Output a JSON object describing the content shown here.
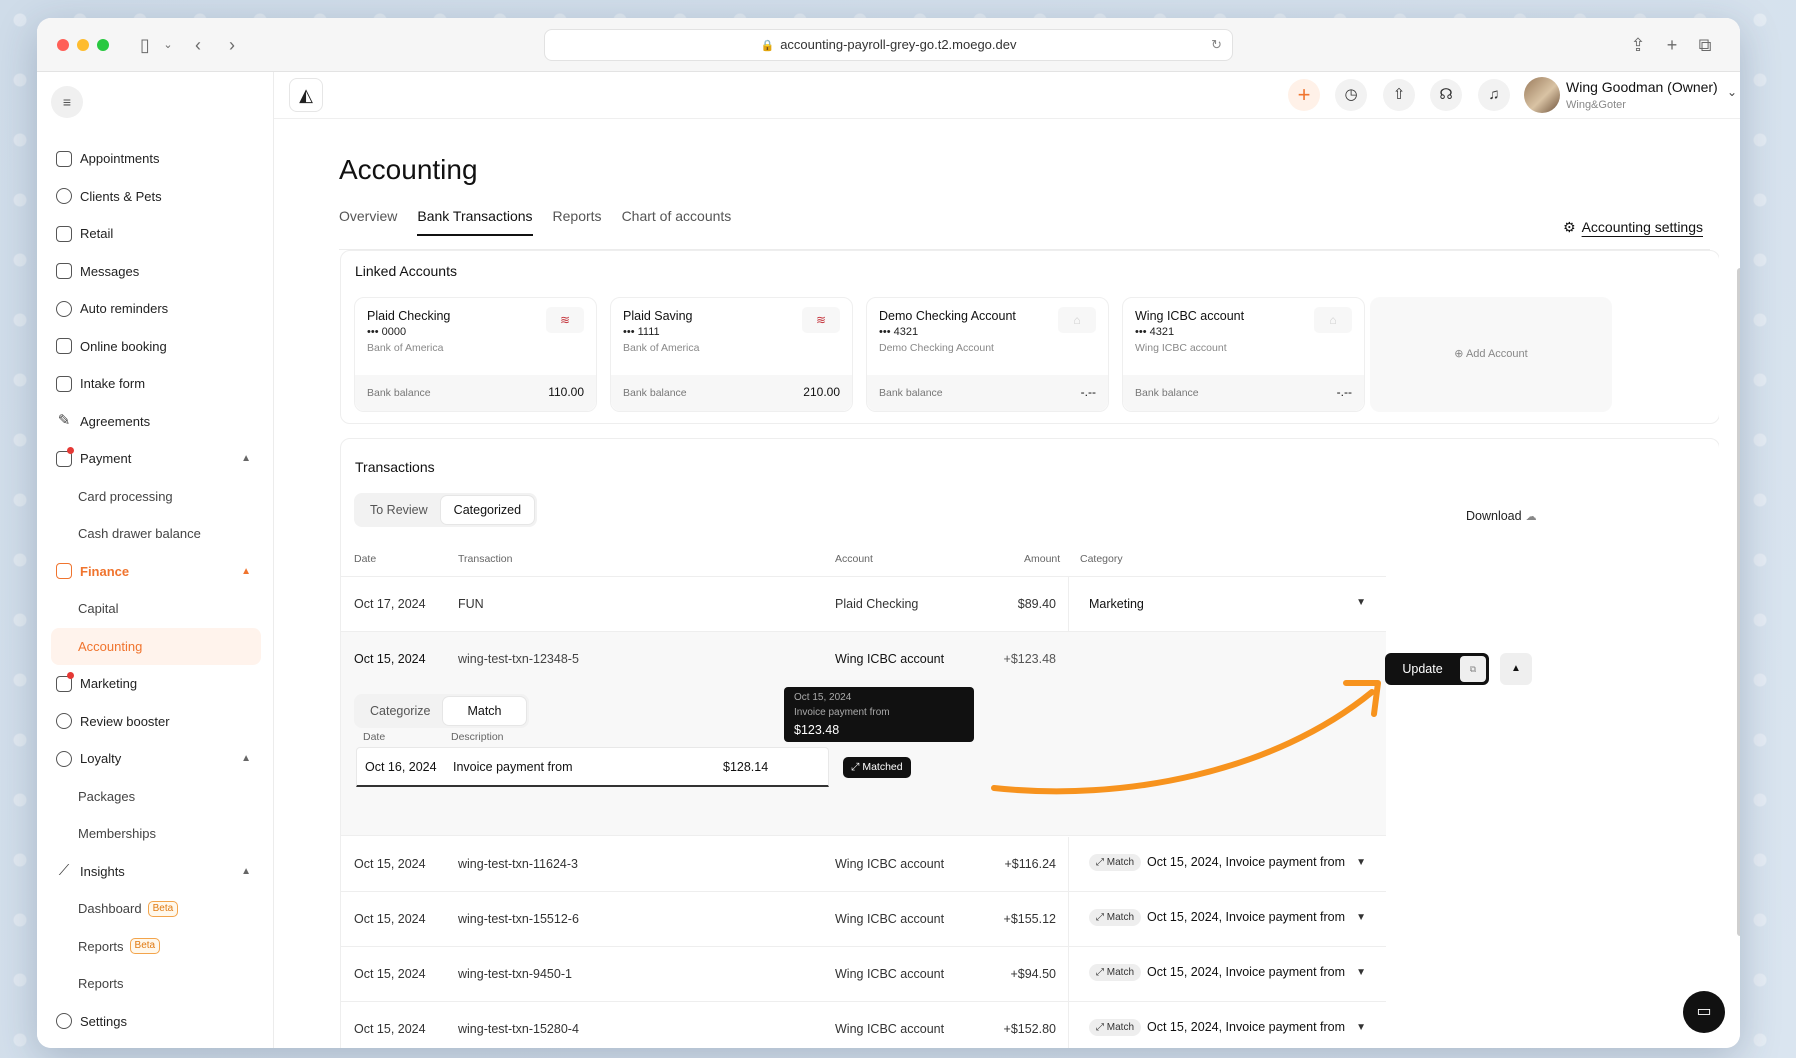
{
  "browser": {
    "url": "accounting-payroll-grey-go.t2.moego.dev"
  },
  "sidebar": {
    "items": [
      {
        "label": "Appointments",
        "icon": "calendar-icon"
      },
      {
        "label": "Clients & Pets",
        "icon": "user-icon"
      },
      {
        "label": "Retail",
        "icon": "store-icon"
      },
      {
        "label": "Messages",
        "icon": "message-icon"
      },
      {
        "label": "Auto reminders",
        "icon": "alarm-icon"
      },
      {
        "label": "Online booking",
        "icon": "booking-icon"
      },
      {
        "label": "Intake form",
        "icon": "clipboard-icon"
      },
      {
        "label": "Agreements",
        "icon": "pen-icon"
      },
      {
        "label": "Payment",
        "icon": "wallet-icon"
      },
      {
        "label": "Card processing"
      },
      {
        "label": "Cash drawer balance"
      },
      {
        "label": "Finance",
        "icon": "bank-icon"
      },
      {
        "label": "Capital"
      },
      {
        "label": "Accounting"
      },
      {
        "label": "Marketing",
        "icon": "megaphone-icon"
      },
      {
        "label": "Review booster",
        "icon": "people-icon"
      },
      {
        "label": "Loyalty",
        "icon": "heart-icon"
      },
      {
        "label": "Packages"
      },
      {
        "label": "Memberships"
      },
      {
        "label": "Insights",
        "icon": "chart-icon"
      },
      {
        "label": "Dashboard",
        "badge": "Beta"
      },
      {
        "label": "Reports",
        "badge": "Beta"
      },
      {
        "label": "Reports"
      },
      {
        "label": "Settings",
        "icon": "gear-icon"
      }
    ]
  },
  "header": {
    "user_name": "Wing Goodman (Owner)",
    "user_org": "Wing&Goter"
  },
  "page": {
    "title": "Accounting",
    "tabs": [
      "Overview",
      "Bank Transactions",
      "Reports",
      "Chart of accounts"
    ],
    "settings_label": "Accounting settings"
  },
  "linked": {
    "title": "Linked Accounts",
    "accounts": [
      {
        "name": "Plaid Checking",
        "number": "••• 0000",
        "bank": "Bank of America",
        "balance_label": "Bank balance",
        "balance": "110.00"
      },
      {
        "name": "Plaid Saving",
        "number": "••• 1111",
        "bank": "Bank of America",
        "balance_label": "Bank balance",
        "balance": "210.00"
      },
      {
        "name": "Demo Checking Account",
        "number": "••• 4321",
        "bank": "Demo Checking Account",
        "balance_label": "Bank balance",
        "balance": "-.--"
      },
      {
        "name": "Wing ICBC account",
        "number": "••• 4321",
        "bank": "Wing ICBC account",
        "balance_label": "Bank balance",
        "balance": "-.--"
      }
    ],
    "add_label": "Add Account"
  },
  "transactions": {
    "title": "Transactions",
    "filters": [
      "To Review",
      "Categorized"
    ],
    "download_label": "Download",
    "columns": {
      "date": "Date",
      "transaction": "Transaction",
      "account": "Account",
      "amount": "Amount",
      "category": "Category"
    },
    "rows": [
      {
        "date": "Oct 17, 2024",
        "transaction": "FUN",
        "account": "Plaid Checking",
        "amount": "$89.40",
        "category": "Marketing"
      },
      {
        "date": "Oct 15, 2024",
        "transaction": "wing-test-txn-12348-5",
        "account": "Wing ICBC account",
        "amount": "+$123.48"
      },
      {
        "date": "Oct 15, 2024",
        "transaction": "wing-test-txn-11624-3",
        "account": "Wing ICBC account",
        "amount": "+$116.24",
        "pill": "Match",
        "category": "Oct 15, 2024, Invoice payment from"
      },
      {
        "date": "Oct 15, 2024",
        "transaction": "wing-test-txn-15512-6",
        "account": "Wing ICBC account",
        "amount": "+$155.12",
        "pill": "Match",
        "category": "Oct 15, 2024, Invoice payment from"
      },
      {
        "date": "Oct 15, 2024",
        "transaction": "wing-test-txn-9450-1",
        "account": "Wing ICBC account",
        "amount": "+$94.50",
        "pill": "Match",
        "category": "Oct 15, 2024, Invoice payment from"
      },
      {
        "date": "Oct 15, 2024",
        "transaction": "wing-test-txn-15280-4",
        "account": "Wing ICBC account",
        "amount": "+$152.80",
        "pill": "Match",
        "category": "Oct 15, 2024, Invoice payment from"
      }
    ],
    "expanded": {
      "modes": [
        "Categorize",
        "Match"
      ],
      "update_label": "Update",
      "match_columns": {
        "date": "Date",
        "description": "Description"
      },
      "match_row": {
        "date": "Oct 16, 2024",
        "description": "Invoice payment from",
        "amount": "$128.14"
      },
      "matched_label": "Matched",
      "tooltip": {
        "date": "Oct 15, 2024",
        "desc": "Invoice payment from",
        "amount": "$123.48"
      }
    }
  },
  "colors": {
    "accent": "#f0742e",
    "annotation_arrow": "#f7931e"
  }
}
